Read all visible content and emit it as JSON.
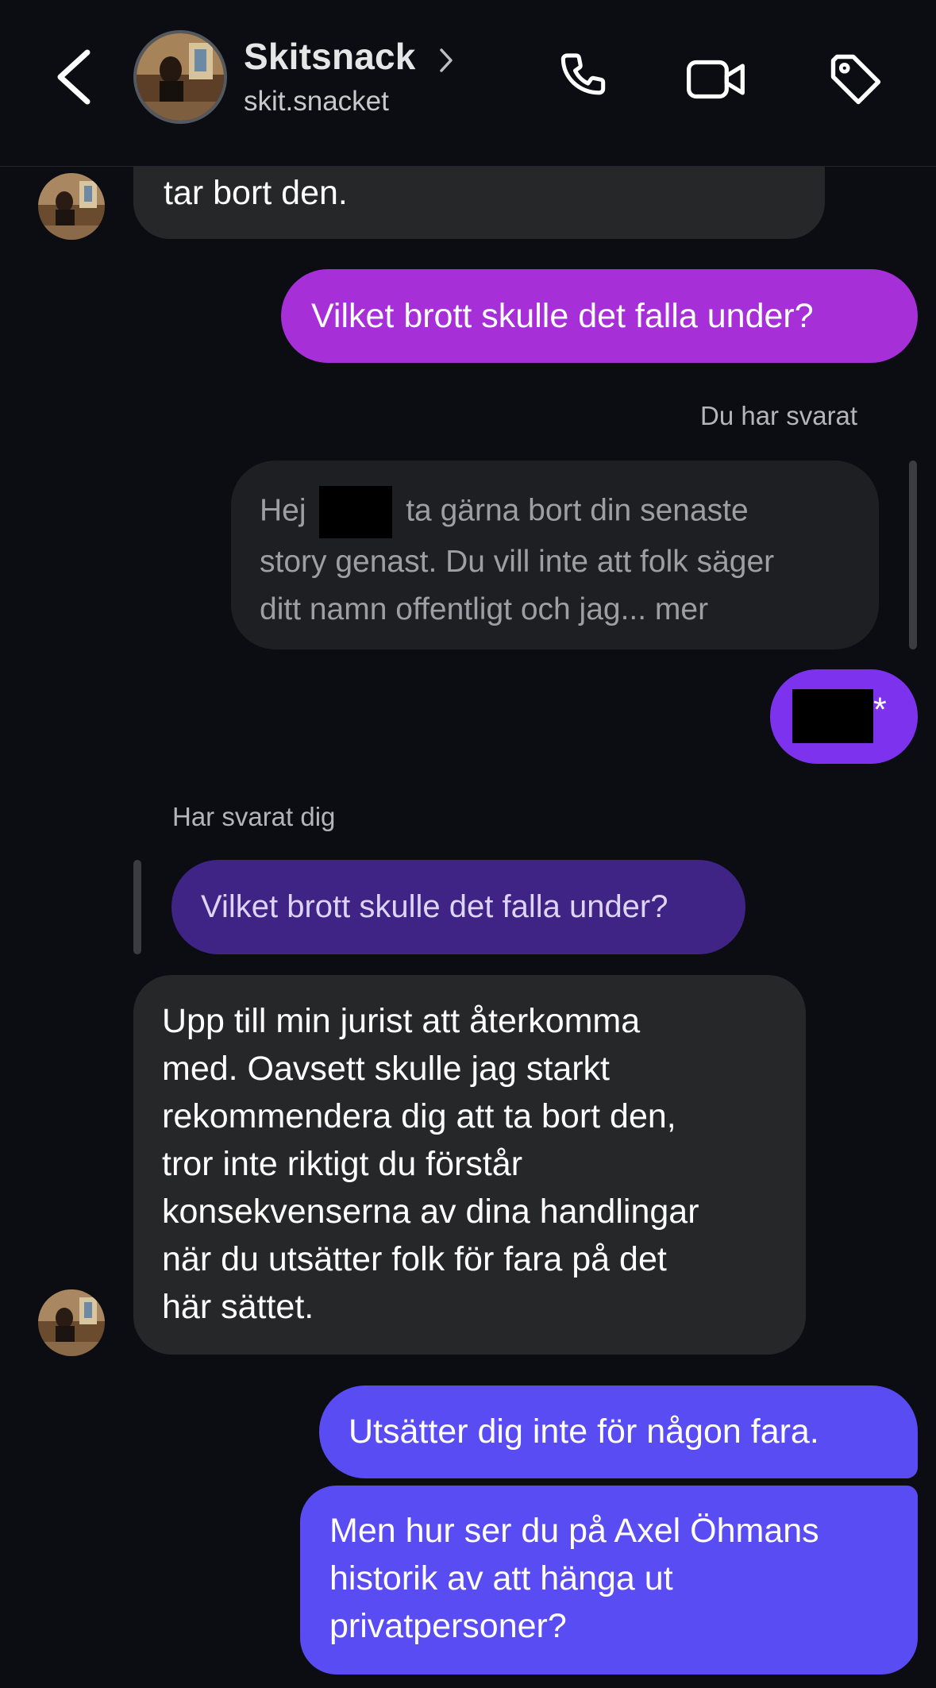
{
  "header": {
    "title": "Skitsnack",
    "username": "skit.snacket",
    "icons": [
      "back-chevron-icon",
      "phone-icon",
      "video-camera-icon",
      "tag-icon"
    ]
  },
  "messages": {
    "m1_text": "tar bort den.",
    "m2_text": "Vilket brott skulle det falla under?",
    "m3_meta": "Du har svarat",
    "m3_quote_line1_pre": "Hej",
    "m3_quote_line1_post": "ta gärna bort din senaste",
    "m3_quote_line2": "story genast. Du vill inte att folk säger",
    "m3_quote_line3": "ditt namn offentligt och jag... mer",
    "m4_suffix": "*",
    "m5_meta": "Har svarat dig",
    "m5_quote": "Vilket brott skulle det falla under?",
    "m6_lines": [
      "Upp till min jurist att återkomma",
      "med. Oavsett skulle jag starkt",
      "rekommendera dig att ta bort den,",
      "tror inte riktigt du förstår",
      "konsekvenserna av dina handlingar",
      "när du utsätter folk för fara på det",
      "här sättet."
    ],
    "m7_text": "Utsätter dig inte för någon fara.",
    "m8_lines": [
      "Men hur ser du på Axel Öhmans",
      "historik av att hänga ut",
      "privatpersoner?"
    ]
  },
  "colors": {
    "background": "#0b0d12",
    "incoming_bubble": "#262729",
    "outgoing_pink_purple": "#a62fd8",
    "outgoing_violet": "#7d33ee",
    "outgoing_blue": "#5a4cf3",
    "replied_bubble": "#3f2385"
  }
}
